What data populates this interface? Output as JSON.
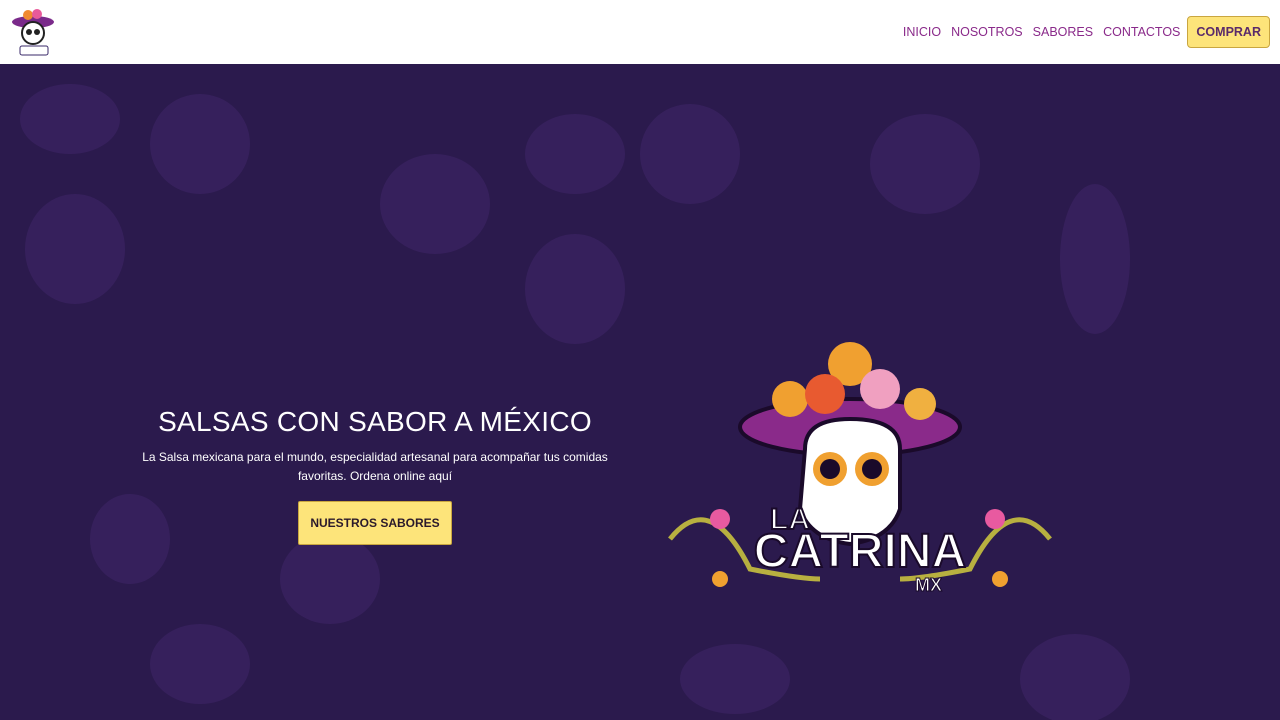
{
  "nav": {
    "logo_text": "LA CATRINA MX",
    "items": [
      {
        "label": "INICIO"
      },
      {
        "label": "NOSOTROS"
      },
      {
        "label": "SABORES"
      },
      {
        "label": "CONTACTOS"
      }
    ],
    "buy_label": "COMPRAR"
  },
  "hero": {
    "title": "SALSAS CON SABOR A MÉXICO",
    "subtitle": "La Salsa mexicana para el mundo, especialidad artesanal para acompañar tus comidas favoritas. Ordena online aquí",
    "cta_label": "NUESTROS SABORES",
    "logo_line1": "LA",
    "logo_line2": "CATRINA",
    "logo_line3": "MX"
  },
  "colors": {
    "background": "#2b1a4d",
    "accent": "#fde47a",
    "nav_link": "#8a2a8a"
  }
}
